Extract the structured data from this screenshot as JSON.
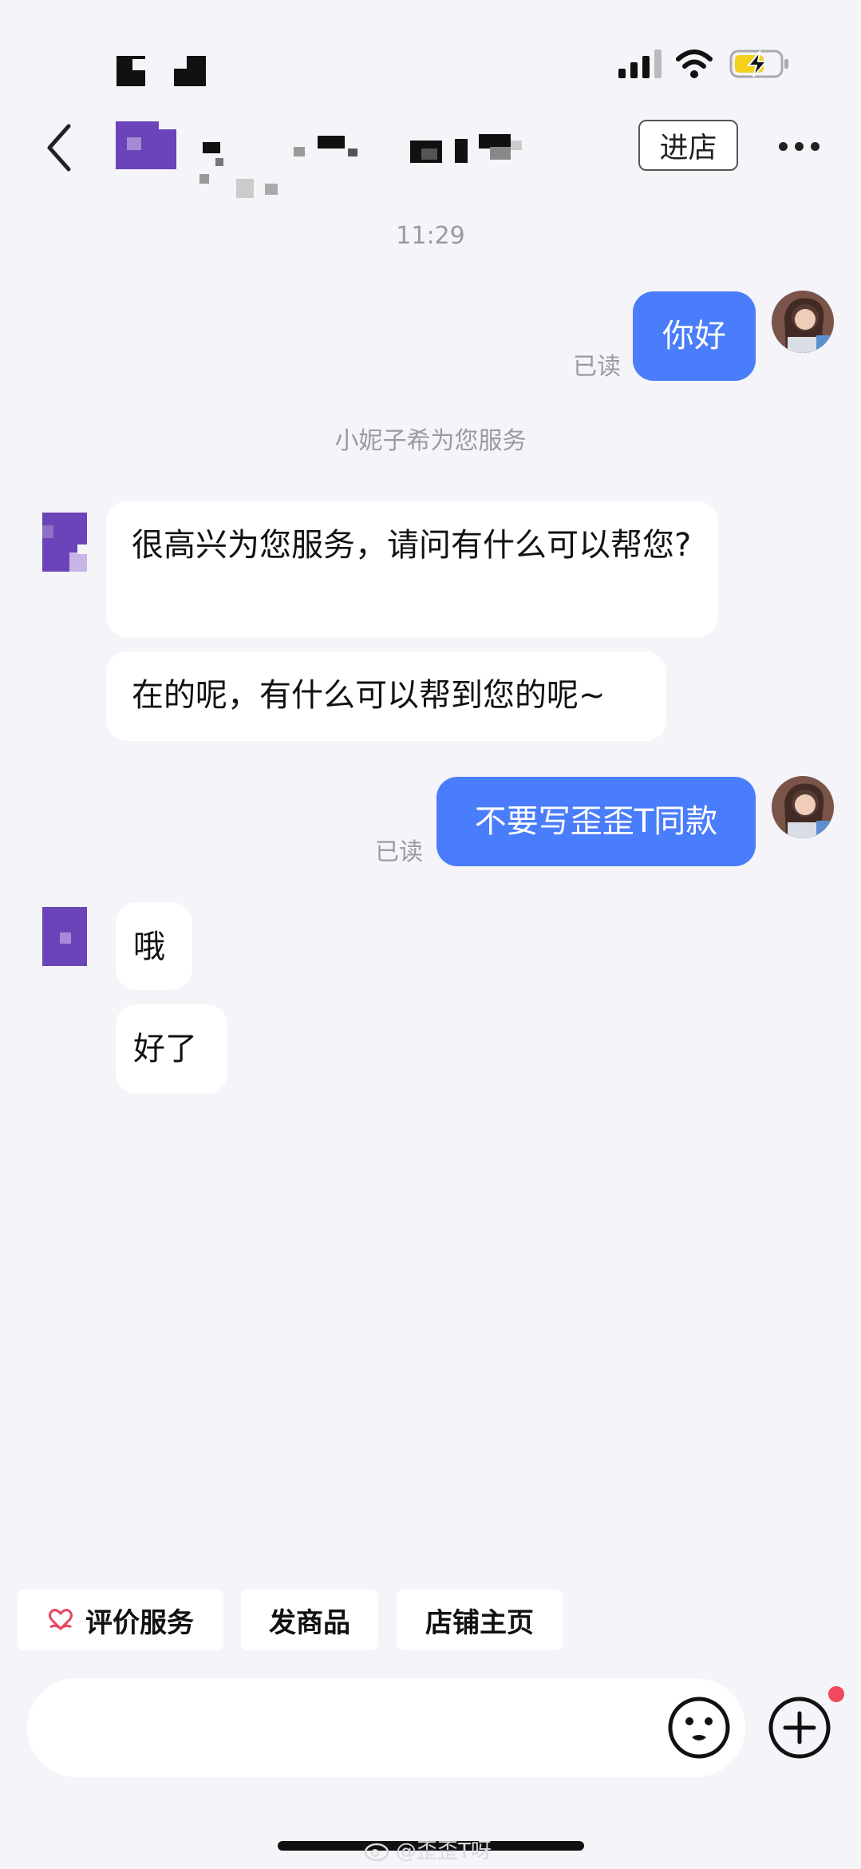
{
  "header": {
    "enter_store_label": "进店"
  },
  "chat": {
    "timestamp": "11:29",
    "system_note": "小妮子希为您服务",
    "messages": [
      {
        "side": "mine",
        "text": "你好",
        "status": "已读"
      },
      {
        "side": "theirs",
        "text": "很高兴为您服务，请问有什么可以帮您?"
      },
      {
        "side": "theirs",
        "text": "在的呢，有什么可以帮到您的呢~"
      },
      {
        "side": "mine",
        "text": "不要写歪歪T同款",
        "status": "已读"
      },
      {
        "side": "theirs",
        "text": "哦"
      },
      {
        "side": "theirs",
        "text": "好了"
      }
    ]
  },
  "quick_actions": [
    {
      "label": "评价服务",
      "icon": "heart-hand-icon"
    },
    {
      "label": "发商品"
    },
    {
      "label": "店铺主页"
    }
  ],
  "input": {
    "placeholder": ""
  },
  "watermark": {
    "text": "@歪歪T呀",
    "icon": "weibo-icon"
  },
  "colors": {
    "background": "#f4f4f9",
    "my_bubble": "#4a7dfb",
    "their_bubble": "#ffffff",
    "accent_red": "#f0485e",
    "shop_avatar_purple": "#6a44b8"
  }
}
